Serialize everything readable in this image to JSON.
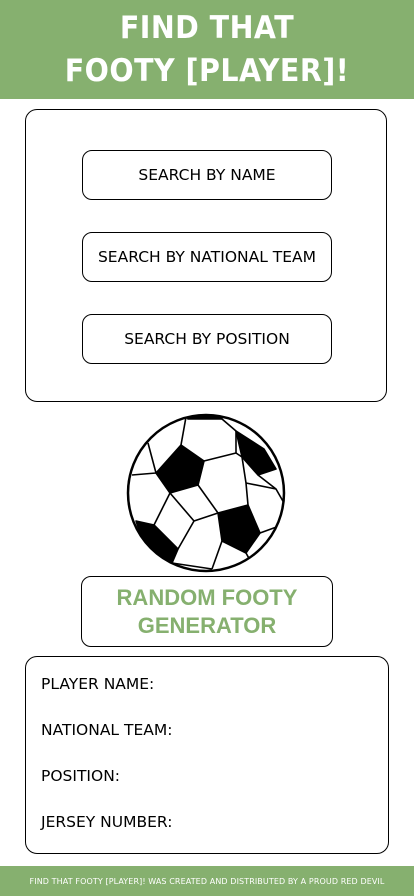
{
  "header": {
    "title_line1": "FIND THAT",
    "title_line2": "FOOTY [PLAYER]!"
  },
  "search": {
    "by_name": "SEARCH BY NAME",
    "by_national_team": "SEARCH BY NATIONAL TEAM",
    "by_position": "SEARCH BY POSITION"
  },
  "ball": {
    "icon": "soccer-ball-icon"
  },
  "random": {
    "label": "RANDOM FOOTY GENERATOR"
  },
  "player_info": {
    "name_label": "PLAYER NAME:",
    "team_label": "NATIONAL TEAM:",
    "position_label": "POSITION:",
    "jersey_label": "JERSEY NUMBER:"
  },
  "footer": {
    "text": "FIND THAT FOOTY [PLAYER]! WAS CREATED AND DISTRIBUTED BY A PROUD RED DEVIL"
  },
  "colors": {
    "accent": "#86b06f",
    "text": "#000000",
    "background": "#ffffff"
  }
}
